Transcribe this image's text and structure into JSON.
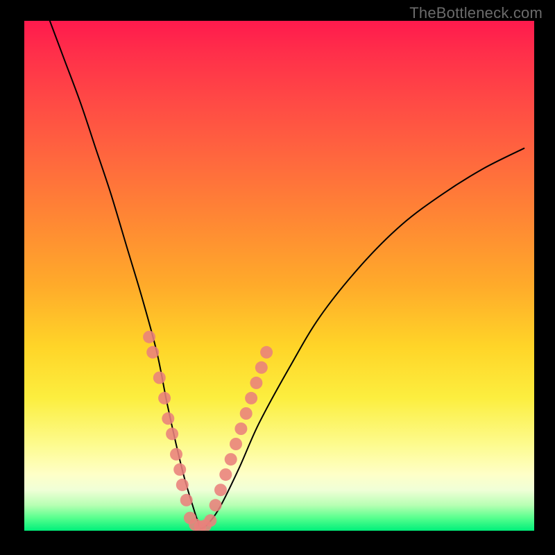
{
  "watermark": "TheBottleneck.com",
  "chart_data": {
    "type": "line",
    "title": "",
    "xlabel": "",
    "ylabel": "",
    "xlim": [
      0,
      100
    ],
    "ylim": [
      0,
      100
    ],
    "series": [
      {
        "name": "curve",
        "x": [
          5,
          8,
          11,
          14,
          17,
          20,
          23,
          26,
          28,
          30,
          31.5,
          33,
          34,
          35,
          38,
          42,
          46,
          52,
          58,
          66,
          74,
          82,
          90,
          98
        ],
        "y": [
          100,
          92,
          84,
          75,
          66,
          56,
          46,
          35,
          25,
          16,
          10,
          5,
          2,
          0.5,
          4,
          12,
          21,
          32,
          42,
          52,
          60,
          66,
          71,
          75
        ]
      }
    ],
    "annotations": {
      "dots_left_branch": [
        {
          "x": 24.5,
          "y": 38
        },
        {
          "x": 25.2,
          "y": 35
        },
        {
          "x": 26.5,
          "y": 30
        },
        {
          "x": 27.5,
          "y": 26
        },
        {
          "x": 28.2,
          "y": 22
        },
        {
          "x": 29.0,
          "y": 19
        },
        {
          "x": 29.8,
          "y": 15
        },
        {
          "x": 30.5,
          "y": 12
        },
        {
          "x": 31.0,
          "y": 9
        },
        {
          "x": 31.8,
          "y": 6
        }
      ],
      "dots_bottom": [
        {
          "x": 32.5,
          "y": 2.5
        },
        {
          "x": 33.5,
          "y": 1.2
        },
        {
          "x": 34.5,
          "y": 0.8
        },
        {
          "x": 35.5,
          "y": 1.0
        },
        {
          "x": 36.5,
          "y": 2.0
        }
      ],
      "dots_right_branch": [
        {
          "x": 37.5,
          "y": 5
        },
        {
          "x": 38.5,
          "y": 8
        },
        {
          "x": 39.5,
          "y": 11
        },
        {
          "x": 40.5,
          "y": 14
        },
        {
          "x": 41.5,
          "y": 17
        },
        {
          "x": 42.5,
          "y": 20
        },
        {
          "x": 43.5,
          "y": 23
        },
        {
          "x": 44.5,
          "y": 26
        },
        {
          "x": 45.5,
          "y": 29
        },
        {
          "x": 46.5,
          "y": 32
        },
        {
          "x": 47.5,
          "y": 35
        }
      ]
    }
  }
}
